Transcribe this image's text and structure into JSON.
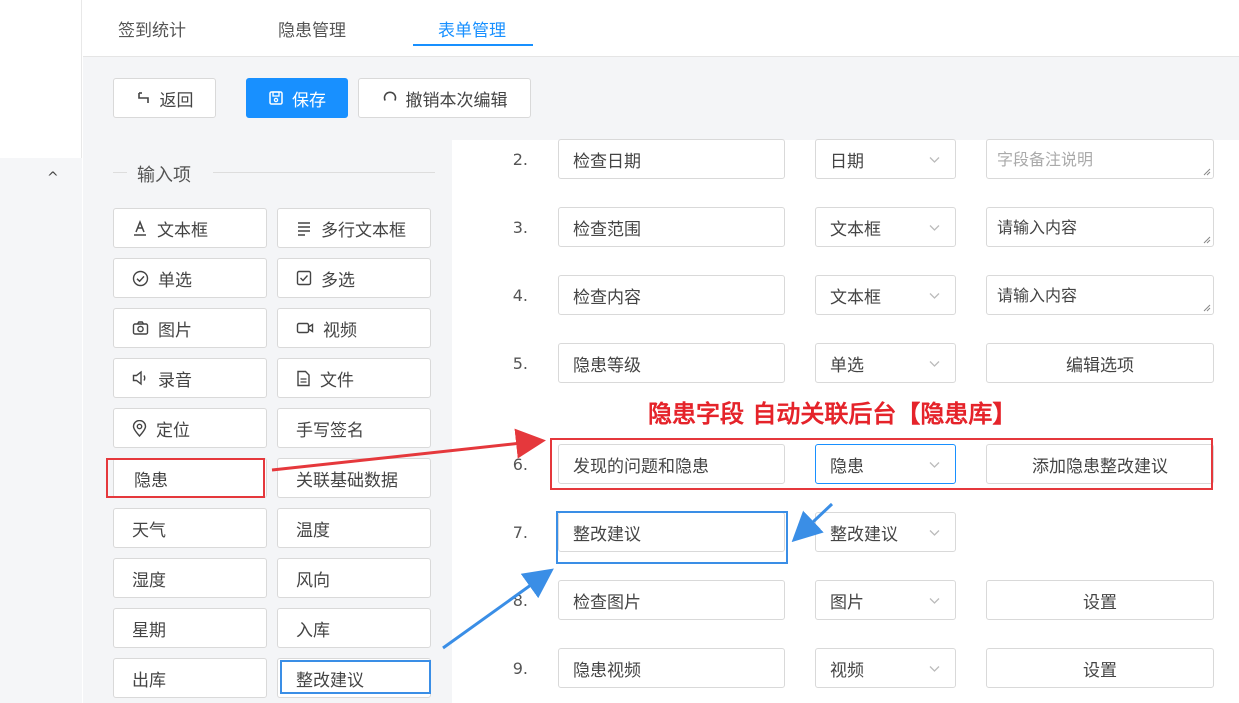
{
  "nav": {
    "collapse_glyph": "^"
  },
  "tabs": [
    {
      "label": "签到统计",
      "active": false
    },
    {
      "label": "隐患管理",
      "active": false
    },
    {
      "label": "表单管理",
      "active": true
    }
  ],
  "toolbar": {
    "back_label": "返回",
    "save_label": "保存",
    "undo_label": "撤销本次编辑"
  },
  "palette": {
    "title": "输入项",
    "items": [
      {
        "label": "文本框",
        "icon": "text-a-icon"
      },
      {
        "label": "多行文本框",
        "icon": "lines-icon"
      },
      {
        "label": "单选",
        "icon": "radio-check-icon"
      },
      {
        "label": "多选",
        "icon": "checkbox-icon"
      },
      {
        "label": "图片",
        "icon": "camera-icon"
      },
      {
        "label": "视频",
        "icon": "video-icon"
      },
      {
        "label": "录音",
        "icon": "speaker-icon"
      },
      {
        "label": "文件",
        "icon": "file-icon"
      },
      {
        "label": "定位",
        "icon": "location-pin-icon"
      },
      {
        "label": "手写签名",
        "icon": ""
      },
      {
        "label": "隐患",
        "icon": ""
      },
      {
        "label": "关联基础数据",
        "icon": ""
      },
      {
        "label": "天气",
        "icon": ""
      },
      {
        "label": "温度",
        "icon": ""
      },
      {
        "label": "湿度",
        "icon": ""
      },
      {
        "label": "风向",
        "icon": ""
      },
      {
        "label": "星期",
        "icon": ""
      },
      {
        "label": "入库",
        "icon": ""
      },
      {
        "label": "出库",
        "icon": ""
      },
      {
        "label": "整改建议",
        "icon": ""
      }
    ]
  },
  "form_rows": [
    {
      "num": "2.",
      "name": "检查日期",
      "type": "日期",
      "extra_kind": "textarea",
      "extra": "字段备注说明",
      "extra_placeholder": true
    },
    {
      "num": "3.",
      "name": "检查范围",
      "type": "文本框",
      "extra_kind": "textarea",
      "extra": "请输入内容",
      "extra_placeholder": false
    },
    {
      "num": "4.",
      "name": "检查内容",
      "type": "文本框",
      "extra_kind": "textarea",
      "extra": "请输入内容",
      "extra_placeholder": false
    },
    {
      "num": "5.",
      "name": "隐患等级",
      "type": "单选",
      "extra_kind": "button",
      "extra": "编辑选项"
    },
    {
      "num": "6.",
      "name": "发现的问题和隐患",
      "type": "隐患",
      "extra_kind": "button",
      "extra": "添加隐患整改建议"
    },
    {
      "num": "7.",
      "name": "整改建议",
      "type": "整改建议",
      "extra_kind": "none",
      "extra": ""
    },
    {
      "num": "8.",
      "name": "检查图片",
      "type": "图片",
      "extra_kind": "button",
      "extra": "设置"
    },
    {
      "num": "9.",
      "name": "隐患视频",
      "type": "视频",
      "extra_kind": "button",
      "extra": "设置"
    }
  ],
  "annotation": {
    "text": "隐患字段 自动关联后台【隐患库】",
    "red_color": "#e5383c",
    "blue_color": "#3a8ee6"
  },
  "colors": {
    "accent": "#1890ff"
  }
}
